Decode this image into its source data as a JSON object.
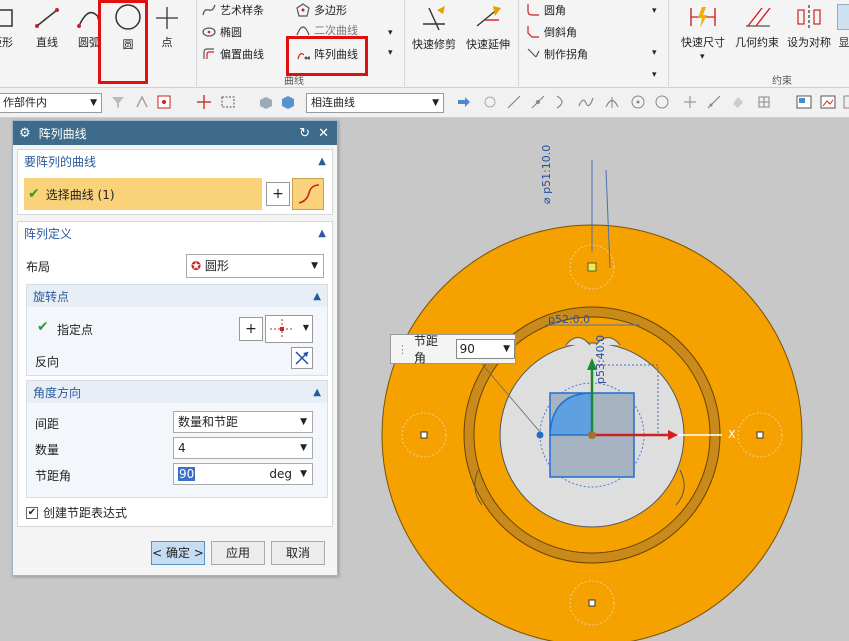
{
  "ribbon": {
    "curve_tools": {
      "rect": "矩形",
      "line": "直线",
      "arc": "圆弧",
      "circle": "圆",
      "point": "点"
    },
    "spline_group": {
      "art_spline": "艺术样条",
      "polygon": "多边形",
      "ellipse": "椭圆",
      "conic": "二次曲线",
      "offset": "偏置曲线",
      "pattern": "阵列曲线",
      "label": "曲线"
    },
    "edit_tools": {
      "quick_trim": "快速修剪",
      "quick_extend": "快速延伸"
    },
    "corner_group": {
      "fillet": "圆角",
      "chamfer": "倒斜角",
      "make_corner": "制作拐角"
    },
    "constraint_group": {
      "quick_dim": "快速尺寸",
      "geo_constraint": "几何约束",
      "set_symmetric": "设为对称",
      "display": "显",
      "label": "约束"
    }
  },
  "toolbar": {
    "scope": "作部件内",
    "curve_rule": "相连曲线"
  },
  "dialog": {
    "title": "阵列曲线",
    "curves_section": {
      "title": "要阵列的曲线",
      "select_label": "选择曲线 (1)"
    },
    "pattern_section": {
      "title": "阵列定义",
      "layout_label": "布局",
      "layout_value": "圆形",
      "rotation": {
        "title": "旋转点",
        "specify_point": "指定点",
        "reverse": "反向"
      },
      "angle": {
        "title": "角度方向",
        "spacing_label": "间距",
        "spacing_value": "数量和节距",
        "count_label": "数量",
        "count_value": "4",
        "pitch_label": "节距角",
        "pitch_value": "90",
        "pitch_unit": "deg"
      }
    },
    "create_expr": "创建节距表达式",
    "ok": "< 确定 >",
    "apply": "应用",
    "cancel": "取消"
  },
  "viewport": {
    "dim_p51": "⌀ p51:10.0",
    "dim_p52": "p52:0.0",
    "dim_p53": "p53:40.0",
    "x_label": "X",
    "pitch_popup_label": "节距角",
    "pitch_popup_value": "90"
  },
  "colors": {
    "part": "#f5a200",
    "dialog_title": "#3f6b8a",
    "highlight": "#f9d27a"
  }
}
